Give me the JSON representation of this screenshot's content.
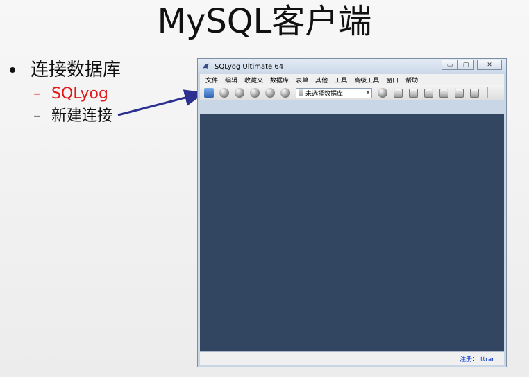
{
  "slide": {
    "title": "MySQL客户端",
    "bullet": "连接数据库",
    "sub_items": [
      "SQLyog",
      "新建连接"
    ],
    "dash": "–"
  },
  "window": {
    "title": "SQLyog Ultimate 64",
    "controls": {
      "minimize": "▭",
      "maximize": "▢",
      "close": "✕"
    },
    "menu": [
      "文件",
      "编辑",
      "收藏夹",
      "数据库",
      "表单",
      "其他",
      "工具",
      "高级工具",
      "窗口",
      "帮助"
    ],
    "db_select": {
      "value": "未选择数据库",
      "caret": "▾"
    },
    "toolbar_icons": [
      "new-connection-icon",
      "disconnect-icon",
      "execute-query-icon",
      "execute-all-icon",
      "stop-icon",
      "refresh-icon"
    ],
    "toolbar_icons_right": [
      "user-icon",
      "db-add-icon",
      "db-table-icon",
      "db-copy-icon",
      "schema-icon",
      "grid-icon",
      "table-icon"
    ],
    "status_registration": "注册： ttrar"
  },
  "colors": {
    "accent_red": "#e1191b",
    "workspace": "#324561",
    "arrow": "#2b2f8f"
  }
}
